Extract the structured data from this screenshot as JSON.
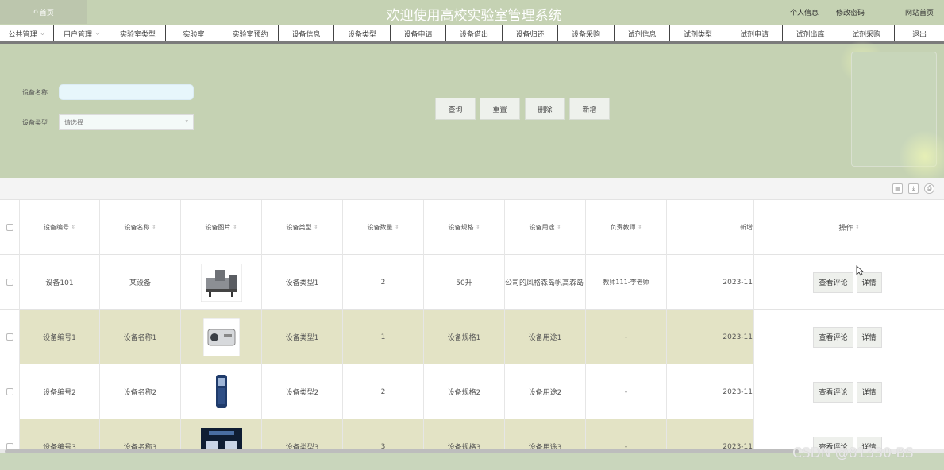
{
  "header": {
    "home": "首页",
    "title": "欢迎使用高校实验室管理系统",
    "profile": "个人信息",
    "change_password": "修改密码",
    "site_home": "网站首页"
  },
  "nav": [
    {
      "label": "公共管理",
      "dropdown": true
    },
    {
      "label": "用户管理",
      "dropdown": true
    },
    {
      "label": "实验室类型"
    },
    {
      "label": "实验室"
    },
    {
      "label": "实验室预约"
    },
    {
      "label": "设备信息"
    },
    {
      "label": "设备类型"
    },
    {
      "label": "设备申请"
    },
    {
      "label": "设备借出"
    },
    {
      "label": "设备归还"
    },
    {
      "label": "设备采购"
    },
    {
      "label": "试剂信息"
    },
    {
      "label": "试剂类型"
    },
    {
      "label": "试剂申请"
    },
    {
      "label": "试剂出库"
    },
    {
      "label": "试剂采购"
    },
    {
      "label": "退出"
    }
  ],
  "search": {
    "name_label": "设备名称",
    "name_value": "",
    "type_label": "设备类型",
    "type_placeholder": "请选择",
    "query": "查询",
    "reset": "重置",
    "delete": "删除",
    "add": "新增"
  },
  "table": {
    "columns": [
      "设备编号",
      "设备名称",
      "设备图片",
      "设备类型",
      "设备数量",
      "设备规格",
      "设备用途",
      "负责教师",
      "新增",
      "操作"
    ],
    "rows": [
      {
        "code": "设备101",
        "name": "某设备",
        "type": "设备类型1",
        "qty": "2",
        "spec": "50升",
        "use": "公司的风格森岛帆高森岛",
        "teacher": "教师111-李老师",
        "date": "2023-11"
      },
      {
        "code": "设备编号1",
        "name": "设备名称1",
        "type": "设备类型1",
        "qty": "1",
        "spec": "设备规格1",
        "use": "设备用途1",
        "teacher": "-",
        "date": "2023-11"
      },
      {
        "code": "设备编号2",
        "name": "设备名称2",
        "type": "设备类型2",
        "qty": "2",
        "spec": "设备规格2",
        "use": "设备用途2",
        "teacher": "-",
        "date": "2023-11"
      },
      {
        "code": "设备编号3",
        "name": "设备名称3",
        "type": "设备类型3",
        "qty": "3",
        "spec": "设备规格3",
        "use": "设备用途3",
        "teacher": "-",
        "date": "2023-11"
      }
    ],
    "view_comments": "查看评论",
    "details": "详情"
  },
  "watermark": "CSDN @81330-BS",
  "colors": {
    "accent_bg": "#c5d2b3",
    "row_alt": "#e3e3c5",
    "nav_border": "#444444"
  }
}
